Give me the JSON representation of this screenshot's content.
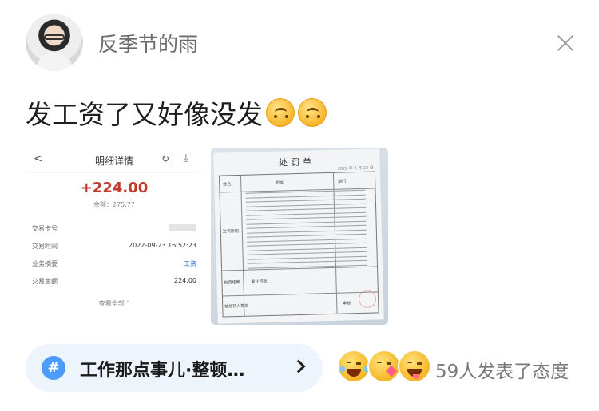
{
  "post": {
    "username": "反季节的雨",
    "text": "发工资了又好像没发"
  },
  "receipt": {
    "back_glyph": "<",
    "title": "明细详情",
    "amount": "+224.00",
    "balance": "余额：275.77",
    "rows": [
      {
        "label": "交易卡号",
        "value": ""
      },
      {
        "label": "交易时间",
        "value": "2022-09-23 16:52:23"
      },
      {
        "label": "业务摘要",
        "value": "工资"
      },
      {
        "label": "交易金额",
        "value": "224.00"
      }
    ],
    "view_all": "查看全部 ˅"
  },
  "document": {
    "title": "处罚单",
    "date": "2022 年 9 月 22 日",
    "labels": {
      "name": "姓名",
      "dept": "部门",
      "post": "职务",
      "penalty": "处罚原因",
      "result": "处罚结果",
      "signature": "被处罚人签名",
      "total": "累计罚款",
      "approver": "审核"
    }
  },
  "topic": {
    "hash": "#",
    "label": "工作那点事儿·整顿…"
  },
  "reactions": {
    "icons": [
      "laughing-crying-face",
      "heart-kiss-face",
      "tongue-out-face"
    ],
    "text": "59人发表了态度"
  }
}
